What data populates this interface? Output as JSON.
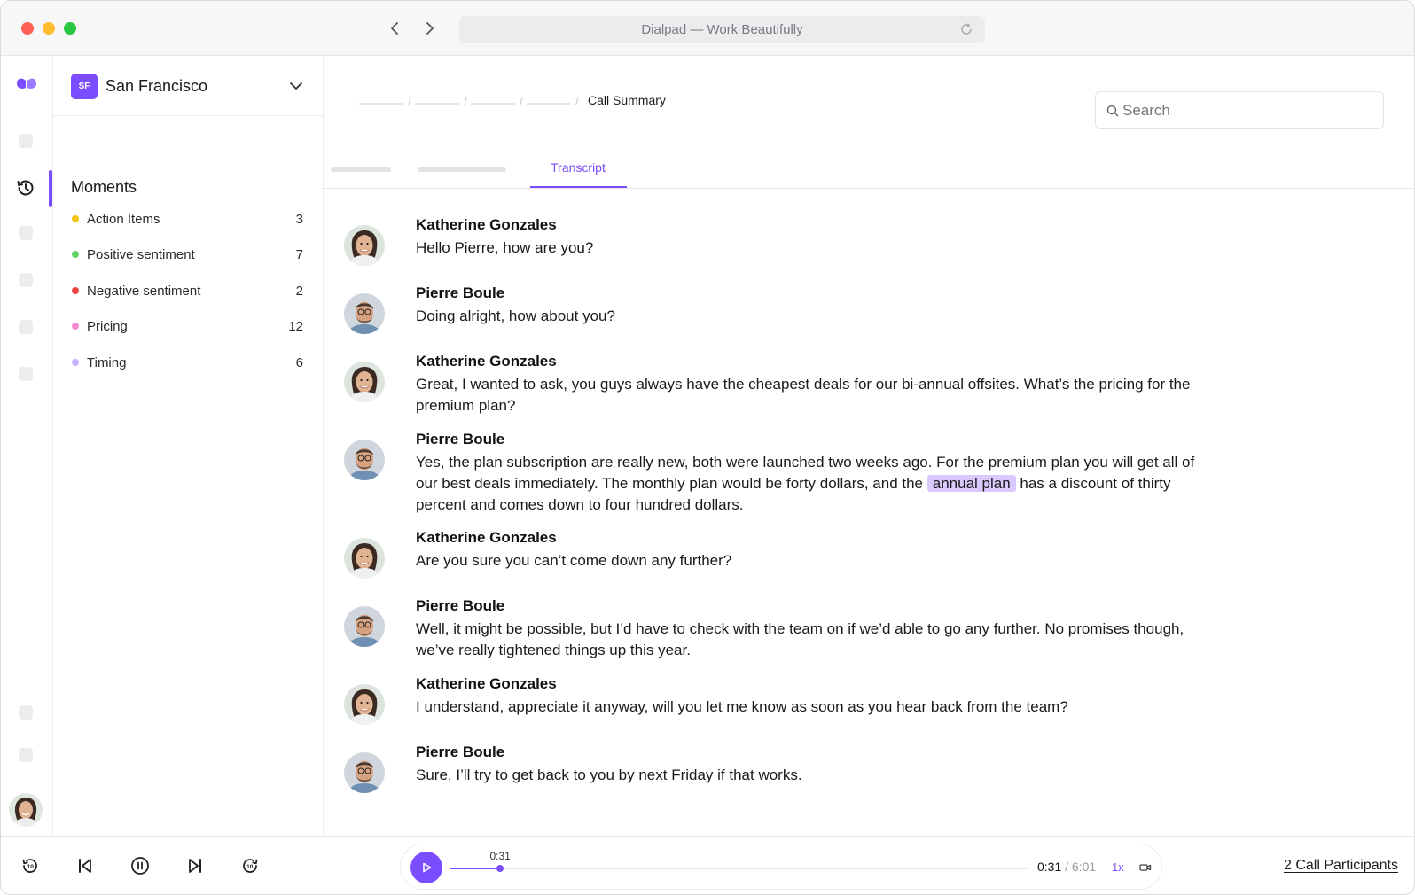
{
  "window": {
    "url_title": "Dialpad — Work Beautifully"
  },
  "office": {
    "badge": "SF",
    "name": "San Francisco"
  },
  "moments": {
    "title": "Moments",
    "items": [
      {
        "label": "Action Items",
        "count": "3",
        "color": "#f5c518"
      },
      {
        "label": "Positive sentiment",
        "count": "7",
        "color": "#5fd35f"
      },
      {
        "label": "Negative sentiment",
        "count": "2",
        "color": "#ef4444"
      },
      {
        "label": "Pricing",
        "count": "12",
        "color": "#f58ad0"
      },
      {
        "label": "Timing",
        "count": "6",
        "color": "#c7b3ff"
      }
    ]
  },
  "breadcrumb": {
    "current": "Call Summary"
  },
  "search": {
    "placeholder": "Search"
  },
  "tabs": {
    "active": "Transcript"
  },
  "transcript": [
    {
      "speaker": "Katherine Gonzales",
      "avatar": "katherine",
      "text": "Hello Pierre, how are you?"
    },
    {
      "speaker": "Pierre Boule",
      "avatar": "pierre",
      "text": "Doing alright, how about you?"
    },
    {
      "speaker": "Katherine Gonzales",
      "avatar": "katherine",
      "text": "Great, I wanted to ask, you guys always have the cheapest deals for our bi-annual offsites. What’s the pricing for the premium plan?"
    },
    {
      "speaker": "Pierre Boule",
      "avatar": "pierre",
      "text_before": "Yes, the plan subscription are really new, both were launched two weeks ago. For the premium plan you will get all of our best deals immediately. The monthly plan would be forty dollars, and the ",
      "highlight": "annual plan",
      "text_after": " has a discount of thirty percent and comes down to four hundred dollars."
    },
    {
      "speaker": "Katherine Gonzales",
      "avatar": "katherine",
      "text": "Are you sure you can’t come down any further?"
    },
    {
      "speaker": "Pierre Boule",
      "avatar": "pierre",
      "text": "Well, it might be possible, but I’d have to check with the team on if we’d able to go any further. No promises though, we’ve really tightened things up this year."
    },
    {
      "speaker": "Katherine Gonzales",
      "avatar": "katherine",
      "text": "I understand, appreciate it anyway, will you let me know as soon as you hear back from the team?"
    },
    {
      "speaker": "Pierre Boule",
      "avatar": "pierre",
      "text": "Sure, I’ll try to get back to you by next Friday if that works."
    }
  ],
  "player": {
    "marker_time": "0:31",
    "current": "0:31",
    "separator": "/",
    "total": "6:01",
    "progress": 0.086,
    "speed": "1x",
    "accent": "#7c4dff"
  },
  "participants": {
    "label": "2 Call Participants"
  }
}
